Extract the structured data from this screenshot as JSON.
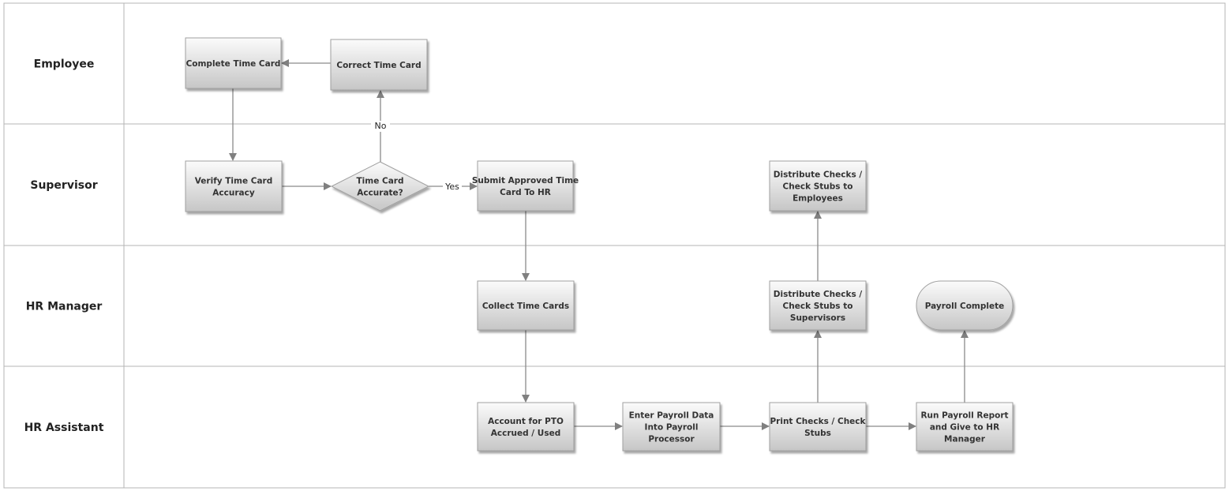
{
  "lanes": [
    {
      "label": "Employee"
    },
    {
      "label": "Supervisor"
    },
    {
      "label": "HR Manager"
    },
    {
      "label": "HR Assistant"
    }
  ],
  "nodes": [
    {
      "id": "complete",
      "shape": "process",
      "lines": [
        "Complete Time Card"
      ]
    },
    {
      "id": "correct",
      "shape": "process",
      "lines": [
        "Correct Time Card"
      ]
    },
    {
      "id": "verify",
      "shape": "process",
      "lines": [
        "Verify Time Card",
        "Accuracy"
      ]
    },
    {
      "id": "decision",
      "shape": "decision",
      "lines": [
        "Time Card",
        "Accurate?"
      ]
    },
    {
      "id": "submit",
      "shape": "process",
      "lines": [
        "Submit Approved Time",
        "Card To HR"
      ]
    },
    {
      "id": "dist_emp",
      "shape": "process",
      "lines": [
        "Distribute Checks /",
        "Check Stubs to",
        "Employees"
      ]
    },
    {
      "id": "collect",
      "shape": "process",
      "lines": [
        "Collect Time Cards"
      ]
    },
    {
      "id": "dist_sup",
      "shape": "process",
      "lines": [
        "Distribute Checks /",
        "Check Stubs to",
        "Supervisors"
      ]
    },
    {
      "id": "complete_payroll",
      "shape": "terminator",
      "lines": [
        "Payroll Complete"
      ]
    },
    {
      "id": "pto",
      "shape": "process",
      "lines": [
        "Account for PTO",
        "Accrued / Used"
      ]
    },
    {
      "id": "enter",
      "shape": "process",
      "lines": [
        "Enter Payroll Data",
        "Into Payroll",
        "Processor"
      ]
    },
    {
      "id": "print",
      "shape": "process",
      "lines": [
        "Print Checks / Check",
        "Stubs"
      ]
    },
    {
      "id": "run",
      "shape": "process",
      "lines": [
        "Run Payroll Report",
        "and Give to HR",
        "Manager"
      ]
    }
  ],
  "edges": [
    {
      "from": "correct",
      "to": "complete"
    },
    {
      "from": "complete",
      "to": "verify"
    },
    {
      "from": "verify",
      "to": "decision"
    },
    {
      "from": "decision",
      "to": "correct",
      "label": "No"
    },
    {
      "from": "decision",
      "to": "submit",
      "label": "Yes"
    },
    {
      "from": "submit",
      "to": "collect"
    },
    {
      "from": "collect",
      "to": "pto"
    },
    {
      "from": "pto",
      "to": "enter"
    },
    {
      "from": "enter",
      "to": "print"
    },
    {
      "from": "print",
      "to": "run"
    },
    {
      "from": "print",
      "to": "dist_sup"
    },
    {
      "from": "dist_sup",
      "to": "dist_emp"
    },
    {
      "from": "run",
      "to": "complete_payroll"
    }
  ],
  "colors": {
    "line": "#8a8a8a",
    "border": "#a0a0a0",
    "fill_top": "#fafafa",
    "fill_bottom": "#c8c8c8"
  }
}
